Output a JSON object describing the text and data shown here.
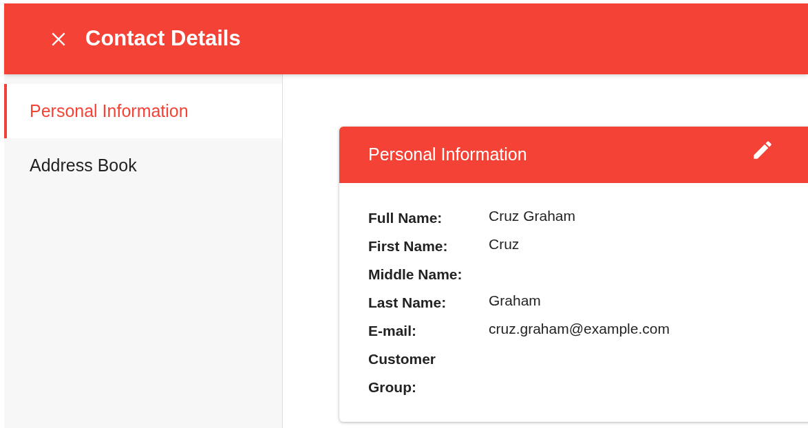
{
  "header": {
    "title": "Contact Details"
  },
  "sidebar": {
    "items": [
      {
        "label": "Personal Information",
        "selected": true
      },
      {
        "label": "Address Book",
        "selected": false
      }
    ]
  },
  "card": {
    "title": "Personal Information",
    "fields": [
      {
        "label": "Full Name:",
        "value": "Cruz Graham"
      },
      {
        "label": "First Name:",
        "value": "Cruz"
      },
      {
        "label": "Middle Name:"
      },
      {
        "label": "Last Name:",
        "value": "Graham"
      },
      {
        "label": "E-mail:",
        "value": "cruz.graham@example.com"
      },
      {
        "label": "Customer Group:"
      }
    ]
  }
}
